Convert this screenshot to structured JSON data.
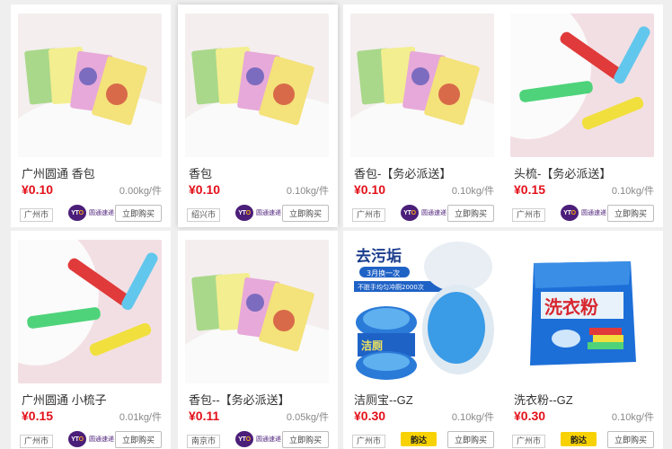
{
  "products": [
    {
      "title": "广州圆通 香包",
      "price": "¥0.10",
      "weight": "0.00kg/件",
      "city": "广州市",
      "courier": "圆通速递",
      "courier_logo": "YTO",
      "buy_label": "立即购买",
      "image": "sachet-packets"
    },
    {
      "title": "香包",
      "price": "¥0.10",
      "weight": "0.10kg/件",
      "city": "绍兴市",
      "courier": "圆通速递",
      "courier_logo": "YTO",
      "buy_label": "立即购买",
      "image": "sachet-packets"
    },
    {
      "title": "香包-【务必派送】",
      "price": "¥0.10",
      "weight": "0.10kg/件",
      "city": "广州市",
      "courier": "圆通速递",
      "courier_logo": "YTO",
      "buy_label": "立即购买",
      "image": "sachet-packets"
    },
    {
      "title": "头梳-【务必派送】",
      "price": "¥0.15",
      "weight": "0.10kg/件",
      "city": "广州市",
      "courier": "圆通速递",
      "courier_logo": "YTO",
      "buy_label": "立即购买",
      "image": "combs"
    },
    {
      "title": "广州圆通 小梳子",
      "price": "¥0.15",
      "weight": "0.01kg/件",
      "city": "广州市",
      "courier": "圆通速递",
      "courier_logo": "YTO",
      "buy_label": "立即购买",
      "image": "combs"
    },
    {
      "title": "香包--【务必派送】",
      "price": "¥0.11",
      "weight": "0.05kg/件",
      "city": "南京市",
      "courier": "圆通速递",
      "courier_logo": "YTO",
      "buy_label": "立即购买",
      "image": "sachet-packets"
    },
    {
      "title": "洁厕宝--GZ",
      "price": "¥0.30",
      "weight": "0.10kg/件",
      "city": "广州市",
      "courier": "韵达",
      "courier_logo": "韵达",
      "buy_label": "立即购买",
      "image": "toilet-cleaner",
      "img_text": {
        "headline": "去污垢",
        "sub": "3月换一次",
        "banner": "不脏手均匀冲厕2000次",
        "tablet": "洁厕"
      }
    },
    {
      "title": "洗衣粉--GZ",
      "price": "¥0.30",
      "weight": "0.10kg/件",
      "city": "广州市",
      "courier": "韵达",
      "courier_logo": "韵达",
      "buy_label": "立即购买",
      "image": "detergent",
      "img_text": {
        "label": "洗衣粉"
      }
    }
  ],
  "colors": {
    "price": "#e3101a",
    "yto": "#4b1e79",
    "yunda": "#f8d200"
  }
}
